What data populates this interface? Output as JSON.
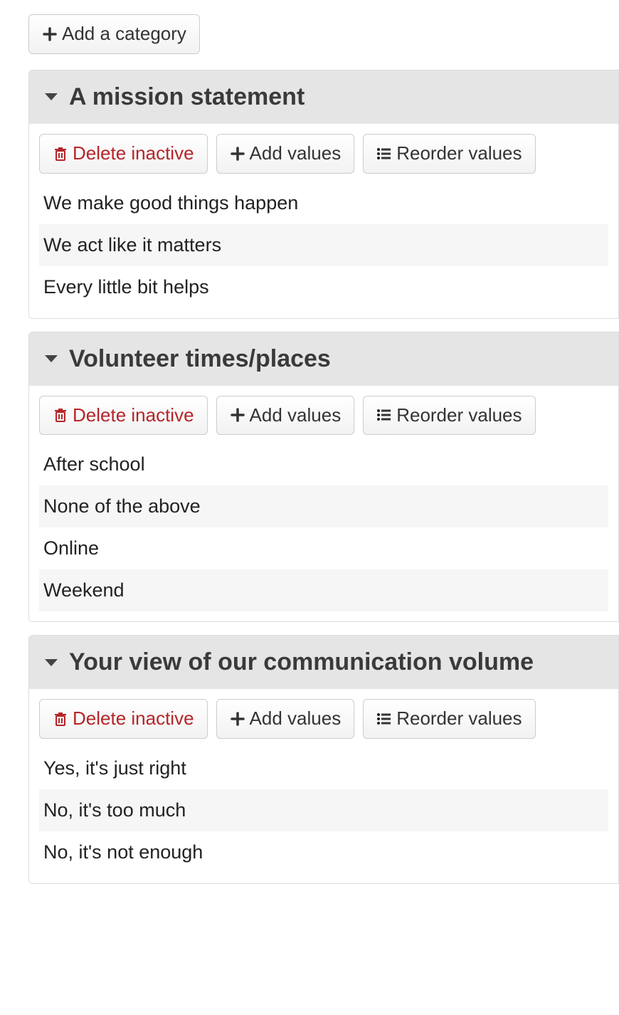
{
  "top": {
    "add_category_label": "Add a category"
  },
  "buttons": {
    "delete_inactive": "Delete inactive",
    "add_values": "Add values",
    "reorder_values": "Reorder values"
  },
  "panels": [
    {
      "title": "A mission statement",
      "values": [
        "We make good things happen",
        "We act like it matters",
        "Every little bit helps"
      ]
    },
    {
      "title": "Volunteer times/places",
      "values": [
        "After school",
        "None of the above",
        "Online",
        "Weekend"
      ]
    },
    {
      "title": "Your view of our communication volume",
      "values": [
        "Yes, it's just right",
        "No, it's too much",
        "No, it's not enough"
      ]
    }
  ]
}
